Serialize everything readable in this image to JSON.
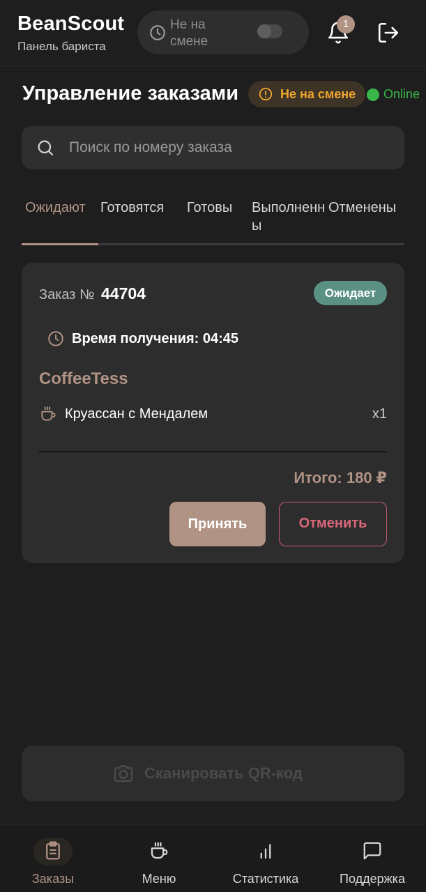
{
  "header": {
    "app_title": "BeanScout",
    "subtitle": "Панель бариста",
    "shift_toggle_label": "Не на смене",
    "notifications_count": "1"
  },
  "title_row": {
    "page_title": "Управление заказами",
    "shift_status": "Не на смене",
    "connection_status": "Online"
  },
  "search": {
    "placeholder": "Поиск по номеру заказа",
    "value": ""
  },
  "tabs": [
    {
      "label": "Ожидают",
      "active": true
    },
    {
      "label": "Готовятся",
      "active": false
    },
    {
      "label": "Готовы",
      "active": false
    },
    {
      "label": "Выполненны",
      "active": false
    },
    {
      "label": "Отменены",
      "active": false
    }
  ],
  "order": {
    "number_prefix": "Заказ №",
    "number": "44704",
    "status": "Ожидает",
    "pickup_time": "Время получения: 04:45",
    "shop_name": "CoffeeTess",
    "items": [
      {
        "name": "Круассан с Мендалем",
        "qty": "x1"
      }
    ],
    "total": "Итого: 180 ₽",
    "accept_label": "Принять",
    "cancel_label": "Отменить"
  },
  "scan_button_label": "Сканировать QR-код",
  "bottom_nav": [
    {
      "label": "Заказы",
      "icon": "clipboard-list-icon",
      "active": true
    },
    {
      "label": "Меню",
      "icon": "coffee-cup-icon",
      "active": false
    },
    {
      "label": "Статистика",
      "icon": "bar-chart-icon",
      "active": false
    },
    {
      "label": "Поддержка",
      "icon": "message-square-icon",
      "active": false
    }
  ],
  "colors": {
    "background": "#1e1e1e",
    "accent": "#b09384",
    "warning": "#f0a72e",
    "online": "#3ab54a",
    "status_waiting": "#5b9184",
    "danger": "#d9677a"
  }
}
